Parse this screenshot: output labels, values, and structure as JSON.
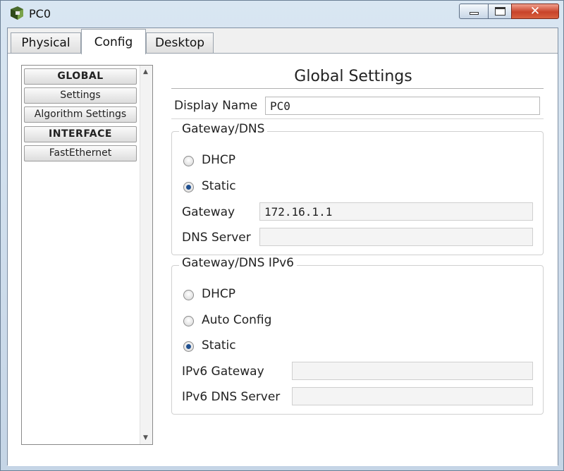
{
  "window": {
    "title": "PC0",
    "close_glyph": "✕"
  },
  "tabs": [
    {
      "label": "Physical"
    },
    {
      "label": "Config"
    },
    {
      "label": "Desktop"
    }
  ],
  "sidebar": {
    "items": [
      {
        "label": "GLOBAL"
      },
      {
        "label": "Settings"
      },
      {
        "label": "Algorithm Settings"
      },
      {
        "label": "INTERFACE"
      },
      {
        "label": "FastEthernet"
      }
    ]
  },
  "global_settings": {
    "title": "Global Settings",
    "display_name_label": "Display Name",
    "display_name_value": "PC0",
    "gateway_dns": {
      "legend": "Gateway/DNS",
      "dhcp_label": "DHCP",
      "static_label": "Static",
      "selected": "Static",
      "gateway_label": "Gateway",
      "gateway_value": "172.16.1.1",
      "dns_label": "DNS Server",
      "dns_value": ""
    },
    "gateway_dns_ipv6": {
      "legend": "Gateway/DNS IPv6",
      "dhcp_label": "DHCP",
      "auto_config_label": "Auto Config",
      "static_label": "Static",
      "selected": "Static",
      "ipv6_gateway_label": "IPv6 Gateway",
      "ipv6_gateway_value": "",
      "ipv6_dns_label": "IPv6 DNS Server",
      "ipv6_dns_value": ""
    }
  }
}
